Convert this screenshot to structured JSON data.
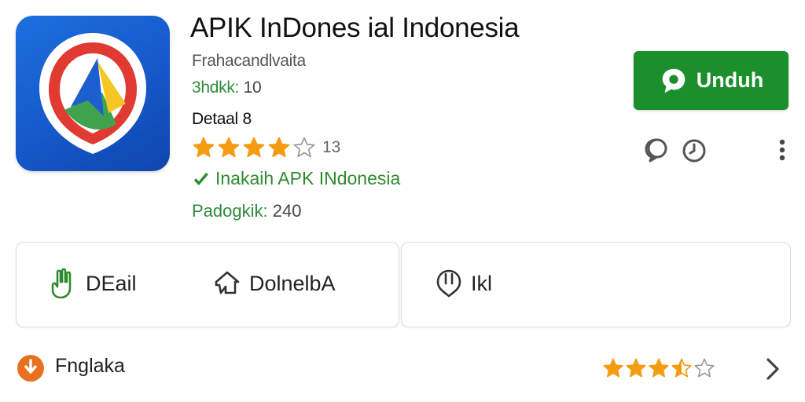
{
  "app": {
    "title": "APIK InDones ial Indonesia",
    "publisher": "Frahacandlvaita",
    "version_label": "3hdkk:",
    "version_value": "10",
    "detail_line": "Detaal 8",
    "rating_value": 4,
    "rating_max": 5,
    "rating_count": "13",
    "install_text": "Inakaih APK INdonesia",
    "downloads_label": "Padogkik:",
    "downloads_value": "240",
    "icon_name": "app-logo-icon"
  },
  "actions": {
    "download_label": "Unduh",
    "download_icon": "chat-bubble-icon",
    "comment_icon": "comment-icon",
    "clock_icon": "clock-icon",
    "more_icon": "more-vertical-icon"
  },
  "tabs": [
    {
      "label": "DEail",
      "icon": "hand-icon"
    },
    {
      "label": "DolnelbA",
      "icon": "share-icon"
    },
    {
      "label": "Ikl",
      "icon": "badge-icon"
    }
  ],
  "footer_row": {
    "label": "Fnglaka",
    "icon": "download-circle-icon",
    "rating_value": 3.5,
    "rating_max": 5
  },
  "colors": {
    "brand_green": "#1a8f2c",
    "star_orange": "#f39c12",
    "icon_blue": "#1558c9",
    "accent_orange": "#e8711f"
  }
}
